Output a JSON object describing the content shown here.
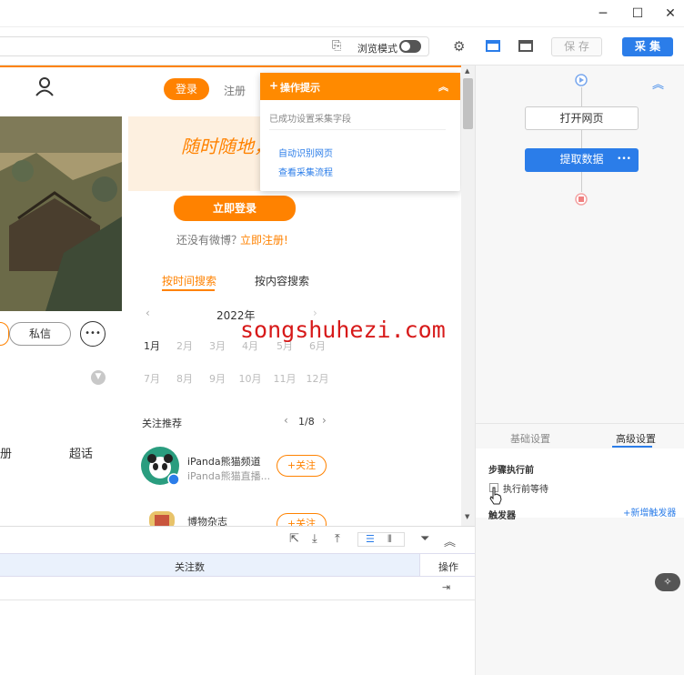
{
  "toolbar": {
    "browse_mode_label": "浏览模式",
    "save_label": "保 存",
    "collect_label": "采 集"
  },
  "webpage": {
    "login_tab": "登录",
    "register_tab": "注册",
    "banner_text": "随时随地，发现新鲜",
    "login_now": "立即登录",
    "no_account": "还没有微博？",
    "register_now": "立即注册!",
    "message_button": "私信",
    "more_button": "•••",
    "tab_left": "册",
    "tab_super": "超话",
    "search_by_time": "按时间搜索",
    "search_by_content": "按内容搜索",
    "year": "2022年",
    "months_row1": [
      "1月",
      "2月",
      "3月",
      "4月",
      "5月",
      "6月"
    ],
    "months_row2": [
      "7月",
      "8月",
      "9月",
      "10月",
      "11月",
      "12月"
    ],
    "recommend_title": "关注推荐",
    "recommend_page": "1/8",
    "rec1_name": "iPanda熊猫频道",
    "rec1_desc": "iPanda熊猫直播...",
    "rec2_name": "博物杂志",
    "follow_label": "+关注",
    "watermark": "songshuhezi.com"
  },
  "tip": {
    "title": "操作提示",
    "message": "已成功设置采集字段",
    "link1": "自动识别网页",
    "link2": "查看采集流程"
  },
  "table": {
    "col_follow": "关注数",
    "col_ops": "操作"
  },
  "flow": {
    "open_page": "打开网页",
    "extract_data": "提取数据",
    "extract_more": "•••"
  },
  "settings": {
    "tab_basic": "基础设置",
    "tab_advanced": "高级设置",
    "before_step_title": "步骤执行前",
    "wait_before": "执行前等待",
    "trigger_title": "触发器",
    "add_trigger": "+新增触发器"
  },
  "colors": {
    "accent_orange": "#ff8200",
    "accent_blue": "#2b7de9"
  }
}
